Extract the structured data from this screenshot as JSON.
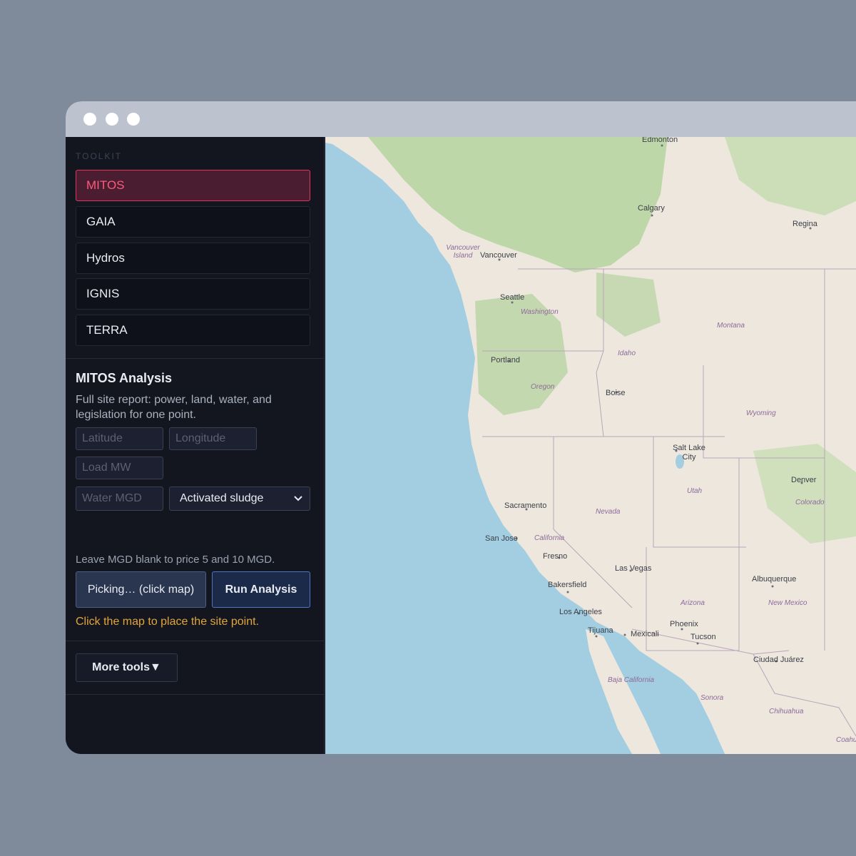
{
  "window": {
    "dots": [
      "window-dot-close",
      "window-dot-minimize",
      "window-dot-maximize"
    ]
  },
  "sidebar": {
    "section_label": "TOOLKIT",
    "tools": [
      {
        "label": "MITOS",
        "active": true
      },
      {
        "label": "GAIA",
        "active": false
      },
      {
        "label": "Hydros",
        "active": false
      },
      {
        "label": "IGNIS",
        "active": false
      },
      {
        "label": "TERRA",
        "active": false
      }
    ]
  },
  "analysis": {
    "title": "MITOS Analysis",
    "description": "Full site report: power, land, water, and legislation for one point.",
    "latitude_placeholder": "Latitude",
    "longitude_placeholder": "Longitude",
    "load_placeholder": "Load MW",
    "water_placeholder": "Water MGD",
    "treatment_selected": "Activated sludge",
    "hint": "Leave MGD blank to price 5 and 10 MGD.",
    "pick_button": "Picking… (click map)",
    "run_button": "Run Analysis",
    "status": "Click the map to place the site point."
  },
  "more_tools": {
    "label": "More tools",
    "icon": "triangle-down-icon"
  },
  "map": {
    "colors": {
      "water": "#a3cde0",
      "land": "#ede7de",
      "forest": "#b5d3a0",
      "border": "#b9a4b9"
    },
    "cities": [
      {
        "name": "Edmonton"
      },
      {
        "name": "Calgary"
      },
      {
        "name": "Regina"
      },
      {
        "name": "Vancouver"
      },
      {
        "name": "Seattle"
      },
      {
        "name": "Portland"
      },
      {
        "name": "Boise"
      },
      {
        "name": "Salt Lake City"
      },
      {
        "name": "Denver"
      },
      {
        "name": "Sacramento"
      },
      {
        "name": "San Jose"
      },
      {
        "name": "Fresno"
      },
      {
        "name": "Las Vegas"
      },
      {
        "name": "Bakersfield"
      },
      {
        "name": "Los Angeles"
      },
      {
        "name": "Tijuana"
      },
      {
        "name": "Mexicali"
      },
      {
        "name": "Phoenix"
      },
      {
        "name": "Tucson"
      },
      {
        "name": "Albuquerque"
      },
      {
        "name": "Ciudad Juárez"
      }
    ],
    "regions": [
      {
        "name": "Vancouver Island"
      },
      {
        "name": "Washington"
      },
      {
        "name": "Montana"
      },
      {
        "name": "Idaho"
      },
      {
        "name": "Oregon"
      },
      {
        "name": "Wyoming"
      },
      {
        "name": "Utah"
      },
      {
        "name": "Colorado"
      },
      {
        "name": "Nevada"
      },
      {
        "name": "California"
      },
      {
        "name": "Arizona"
      },
      {
        "name": "New Mexico"
      },
      {
        "name": "Baja California"
      },
      {
        "name": "Sonora"
      },
      {
        "name": "Chihuahua"
      },
      {
        "name": "Coahu"
      }
    ]
  }
}
